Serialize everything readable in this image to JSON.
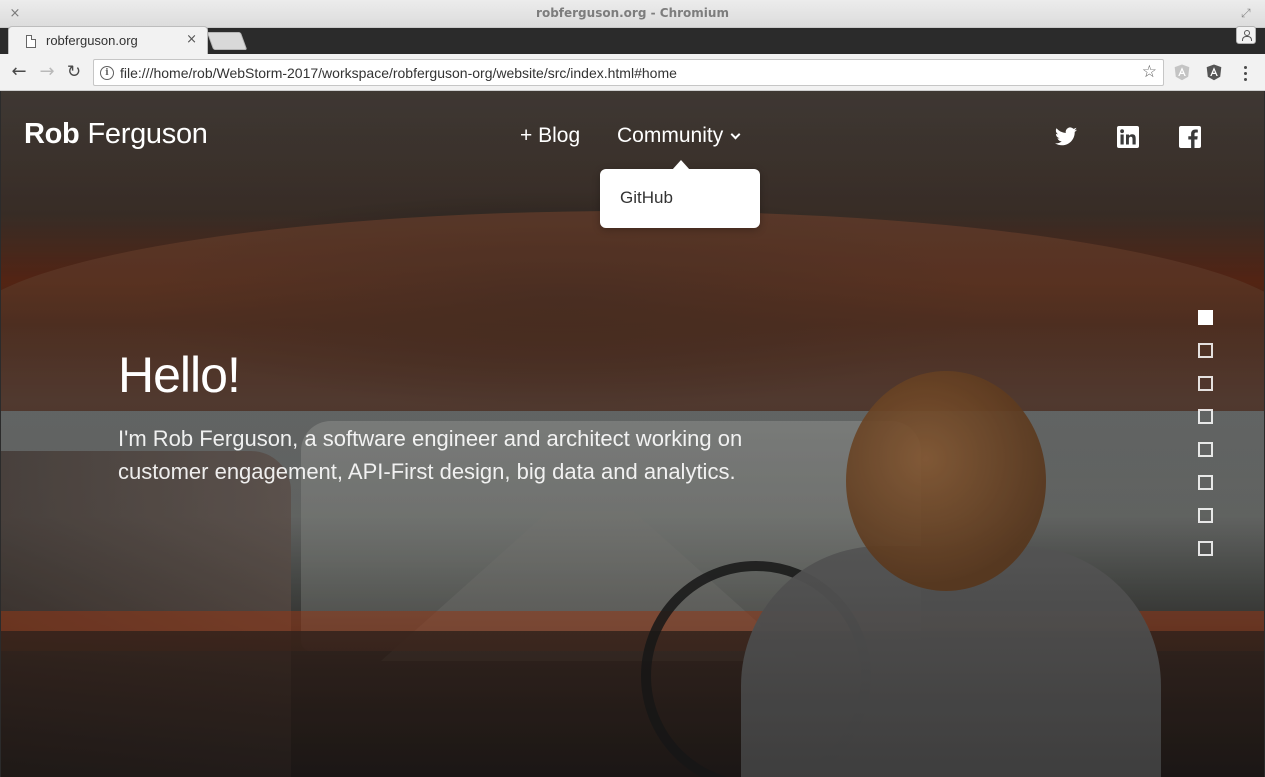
{
  "window": {
    "title": "robferguson.org - Chromium",
    "close_glyph": "×",
    "resize_glyph": "⤢"
  },
  "tab": {
    "title": "robferguson.org",
    "close_glyph": "×"
  },
  "toolbar": {
    "back_glyph": "←",
    "forward_glyph": "→",
    "reload_glyph": "↻",
    "url": "file:///home/rob/WebStorm-2017/workspace/robferguson-org/website/src/index.html#home",
    "info_glyph": "i",
    "star_glyph": "☆",
    "extensions": [
      "angular-extension-gray-icon",
      "angular-extension-dark-icon"
    ]
  },
  "site": {
    "brand_first": "Rob",
    "brand_last": "Ferguson",
    "nav": {
      "blog_label": "+ Blog",
      "community_label": "Community",
      "community_open": true,
      "dropdown_items": [
        "GitHub"
      ]
    },
    "social": [
      "twitter-icon",
      "linkedin-icon",
      "facebook-icon"
    ],
    "hero": {
      "title": "Hello!",
      "subtitle": "I'm Rob Ferguson, a software engineer and architect working on customer engagement, API-First design, big data and analytics."
    },
    "pager": {
      "count": 8,
      "active_index": 0
    }
  },
  "colors": {
    "chrome_bg": "#f2f2f2",
    "text_light": "#ffffff",
    "dropdown_bg": "#ffffff",
    "dropdown_text": "#333333"
  }
}
